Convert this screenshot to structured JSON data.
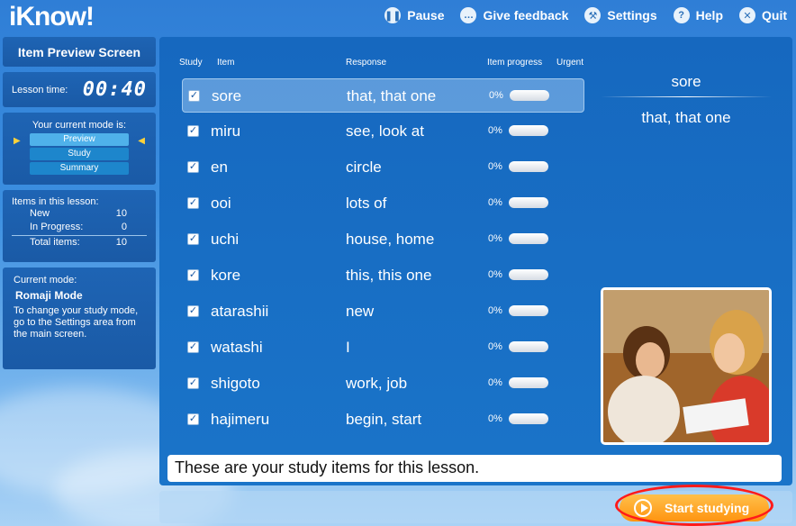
{
  "app": {
    "logo": "iKnow!"
  },
  "nav": [
    {
      "label": "Pause",
      "icon": "pause-icon",
      "glyph": "❚❚"
    },
    {
      "label": "Give feedback",
      "icon": "feedback-icon",
      "glyph": "…"
    },
    {
      "label": "Settings",
      "icon": "settings-icon",
      "glyph": "⚒"
    },
    {
      "label": "Help",
      "icon": "help-icon",
      "glyph": "?"
    },
    {
      "label": "Quit",
      "icon": "quit-icon",
      "glyph": "✕"
    }
  ],
  "sidebar": {
    "title": "Item Preview Screen",
    "lesson_time_label": "Lesson time:",
    "lesson_time": "00:40",
    "mode_heading": "Your current mode is:",
    "modes": [
      "Preview",
      "Study",
      "Summary"
    ],
    "items_heading": "Items in this lesson:",
    "counts": [
      {
        "label": "New",
        "value": "10"
      },
      {
        "label": "In Progress:",
        "value": "0"
      }
    ],
    "total": {
      "label": "Total items:",
      "value": "10"
    },
    "current_mode_label": "Current mode:",
    "current_mode": "Romaji Mode",
    "mode_help": "To change your study mode, go to the Settings area from the main screen."
  },
  "table": {
    "headers": {
      "study": "Study",
      "item": "Item",
      "response": "Response",
      "progress": "Item progress",
      "urgent": "Urgent"
    },
    "rows": [
      {
        "item": "sore",
        "response": "that, that one",
        "progress": "0%",
        "checked": true
      },
      {
        "item": "miru",
        "response": "see, look at",
        "progress": "0%",
        "checked": true
      },
      {
        "item": "en",
        "response": "circle",
        "progress": "0%",
        "checked": true
      },
      {
        "item": "ooi",
        "response": "lots of",
        "progress": "0%",
        "checked": true
      },
      {
        "item": "uchi",
        "response": "house, home",
        "progress": "0%",
        "checked": true
      },
      {
        "item": "kore",
        "response": "this, this one",
        "progress": "0%",
        "checked": true
      },
      {
        "item": "atarashii",
        "response": "new",
        "progress": "0%",
        "checked": true
      },
      {
        "item": "watashi",
        "response": "I",
        "progress": "0%",
        "checked": true
      },
      {
        "item": "shigoto",
        "response": "work, job",
        "progress": "0%",
        "checked": true
      },
      {
        "item": "hajimeru",
        "response": "begin, start",
        "progress": "0%",
        "checked": true
      }
    ]
  },
  "preview": {
    "word": "sore",
    "response": "that, that one"
  },
  "message": "These are your study items for this lesson.",
  "start_button": "Start studying"
}
